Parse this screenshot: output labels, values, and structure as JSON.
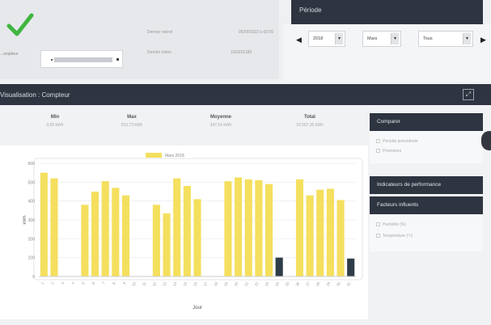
{
  "meter_info": {
    "device_label": "...ompteur",
    "last_reading_label": "Dernier relevé",
    "last_reading_value": "05/09/2023 à 00:55",
    "last_index_label": "Dernier index",
    "last_index_value": "10100/1189"
  },
  "period": {
    "title": "Période",
    "prev_arrow": "◀",
    "next_arrow": "▶",
    "year": "2018",
    "month": "Mars",
    "range": "Tous"
  },
  "visualisation": {
    "title": "Visualisation : Compteur",
    "expand_icon": "expand-icon"
  },
  "stats": [
    {
      "label": "Min",
      "value": "0,00 kWh"
    },
    {
      "label": "Max",
      "value": "553,73 kWh"
    },
    {
      "label": "Moyenne",
      "value": "347,54 kWh"
    },
    {
      "label": "Total",
      "value": "10 567,30 kWh"
    }
  ],
  "compare": {
    "title": "Comparer",
    "options": [
      "Période précédente",
      "Prévisions"
    ]
  },
  "performance": {
    "title": "Indicateurs de performance"
  },
  "factors": {
    "title": "Facteurs influents",
    "options": [
      "Humidité (%)",
      "Température (°c)"
    ]
  },
  "chart_data": {
    "type": "bar",
    "legend": [
      "Mars 2018"
    ],
    "ylabel": "kWh",
    "xlabel": "Jour",
    "ylim": [
      0,
      600
    ],
    "yticks": [
      0,
      100,
      200,
      300,
      400,
      500,
      600
    ],
    "categories": [
      "1",
      "2",
      "3",
      "4",
      "5",
      "6",
      "7",
      "8",
      "9",
      "10",
      "11",
      "12",
      "13",
      "14",
      "15",
      "16",
      "17",
      "18",
      "19",
      "20",
      "21",
      "22",
      "23",
      "24",
      "25",
      "26",
      "27",
      "28",
      "29",
      "30",
      "31"
    ],
    "values": [
      550,
      520,
      0,
      0,
      380,
      450,
      505,
      470,
      430,
      0,
      0,
      380,
      335,
      520,
      480,
      410,
      0,
      0,
      505,
      525,
      515,
      510,
      490,
      100,
      0,
      515,
      430,
      460,
      465,
      405,
      95
    ],
    "highlight_indices": [
      23,
      30
    ],
    "colors": {
      "bar": "#f4df5e",
      "highlight": "#2e3d48"
    }
  }
}
